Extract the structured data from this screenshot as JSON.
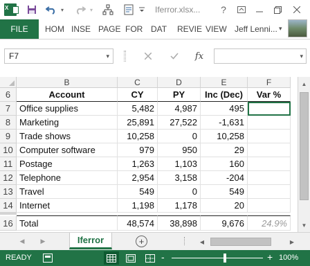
{
  "window": {
    "file_name": "Iferror.xlsx...",
    "app_badge": "X"
  },
  "ribbon": {
    "file_tab": "FILE",
    "tabs": [
      "HOM",
      "INSE",
      "PAGE",
      "FOR",
      "DAT",
      "REVIE",
      "VIEW"
    ],
    "user": "Jeff Lenni..."
  },
  "formula_bar": {
    "name_box": "F7",
    "formula": "",
    "fx_label": "fx"
  },
  "grid": {
    "columns": [
      "B",
      "C",
      "D",
      "E",
      "F"
    ],
    "header_row": {
      "row": "6",
      "cells": [
        "Account",
        "CY",
        "PY",
        "Inc (Dec)",
        "Var %"
      ]
    },
    "rows": [
      {
        "row": "7",
        "cells": [
          "Office supplies",
          "5,482",
          "4,987",
          "495",
          ""
        ]
      },
      {
        "row": "8",
        "cells": [
          "Marketing",
          "25,891",
          "27,522",
          "-1,631",
          ""
        ]
      },
      {
        "row": "9",
        "cells": [
          "Trade shows",
          "10,258",
          "0",
          "10,258",
          ""
        ]
      },
      {
        "row": "10",
        "cells": [
          "Computer software",
          "979",
          "950",
          "29",
          ""
        ]
      },
      {
        "row": "11",
        "cells": [
          "Postage",
          "1,263",
          "1,103",
          "160",
          ""
        ]
      },
      {
        "row": "12",
        "cells": [
          "Telephone",
          "2,954",
          "3,158",
          "-204",
          ""
        ]
      },
      {
        "row": "13",
        "cells": [
          "Travel",
          "549",
          "0",
          "549",
          ""
        ]
      },
      {
        "row": "14",
        "cells": [
          "Internet",
          "1,198",
          "1,178",
          "20",
          ""
        ]
      }
    ],
    "total_row": {
      "row": "16",
      "cells": [
        "Total",
        "48,574",
        "38,898",
        "9,676",
        "24.9%"
      ]
    }
  },
  "sheet_tabs": {
    "active": "Iferror",
    "add_label": "+"
  },
  "status_bar": {
    "status": "READY",
    "zoom_minus": "-",
    "zoom_plus": "+",
    "zoom": "100%",
    "zoom_level": 1.0
  },
  "colors": {
    "accent": "#217346"
  }
}
